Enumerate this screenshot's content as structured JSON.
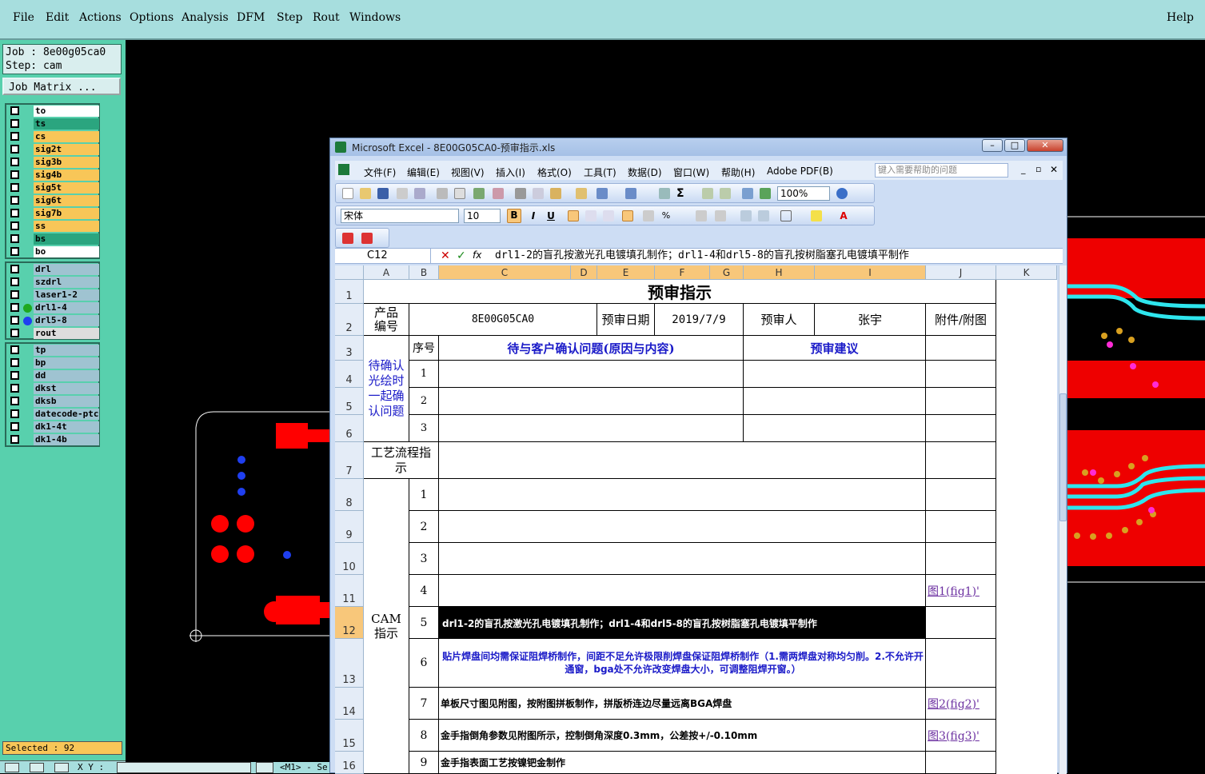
{
  "menubar": {
    "items": [
      "File",
      "Edit",
      "Actions",
      "Options",
      "Analysis",
      "DFM",
      "Step",
      "Rout",
      "Windows"
    ],
    "help": "Help"
  },
  "job": {
    "job_label": "Job : 8e00g05ca0",
    "step_label": "Step: cam",
    "matrix_button": "Job Matrix ..."
  },
  "layers": {
    "group1": [
      {
        "name": "to",
        "color": "#ffffff"
      },
      {
        "name": "ts",
        "color": "#2ba57f"
      },
      {
        "name": "cs",
        "color": "#f8c658"
      },
      {
        "name": "sig2t",
        "color": "#f8c658"
      },
      {
        "name": "sig3b",
        "color": "#f8c658"
      },
      {
        "name": "sig4b",
        "color": "#f8c658"
      },
      {
        "name": "sig5t",
        "color": "#f8c658"
      },
      {
        "name": "sig6t",
        "color": "#f8c658"
      },
      {
        "name": "sig7b",
        "color": "#f8c658"
      },
      {
        "name": "ss",
        "color": "#f8c658"
      },
      {
        "name": "bs",
        "color": "#2ba57f"
      },
      {
        "name": "bo",
        "color": "#ffffff"
      }
    ],
    "group2": [
      {
        "name": "drl",
        "color": "#9fc3d1",
        "mark": ""
      },
      {
        "name": "szdrl",
        "color": "#9fc3d1",
        "mark": ""
      },
      {
        "name": "laser1-2",
        "color": "#9fc3d1",
        "mark": ""
      },
      {
        "name": "drl1-4",
        "color": "#9fc3d1",
        "mark": "#1fa81f"
      },
      {
        "name": "drl5-8",
        "color": "#9fc3d1",
        "mark": "#1f3ff0"
      },
      {
        "name": "rout",
        "color": "#dddddd",
        "mark": ""
      }
    ],
    "group3": [
      {
        "name": "tp",
        "color": "#9fc3d1"
      },
      {
        "name": "bp",
        "color": "#9fc3d1"
      },
      {
        "name": "dd",
        "color": "#9fc3d1"
      },
      {
        "name": "dkst",
        "color": "#9fc3d1"
      },
      {
        "name": "dksb",
        "color": "#9fc3d1"
      },
      {
        "name": "datecode-ptc",
        "color": "#9fc3d1"
      },
      {
        "name": "dk1-4t",
        "color": "#9fc3d1"
      },
      {
        "name": "dk1-4b",
        "color": "#9fc3d1"
      }
    ]
  },
  "status": {
    "selected": "Selected : 92",
    "xy": "X Y :",
    "mode": "<M1> - Se"
  },
  "excel": {
    "title": "Microsoft Excel - 8E00G05CA0-预审指示.xls",
    "menu": [
      "文件(F)",
      "编辑(E)",
      "视图(V)",
      "插入(I)",
      "格式(O)",
      "工具(T)",
      "数据(D)",
      "窗口(W)",
      "帮助(H)",
      "Adobe PDF(B)"
    ],
    "help_placeholder": "键入需要帮助的问题",
    "zoom": "100%",
    "font": "宋体",
    "font_size": "10",
    "name_box": "C12",
    "formula": "drl1-2的盲孔按激光孔电镀填孔制作；drl1-4和drl5-8的盲孔按树脂塞孔电镀填平制作",
    "columns": [
      "A",
      "B",
      "C",
      "D",
      "E",
      "F",
      "G",
      "H",
      "I",
      "J",
      "K"
    ],
    "rows": [
      "1",
      "2",
      "3",
      "4",
      "5",
      "6",
      "7",
      "8",
      "9",
      "10",
      "11",
      "12",
      "13",
      "14",
      "15",
      "16"
    ],
    "sheet": {
      "title": "预审指示",
      "product_no_label": "产品编号",
      "product_no": "8E00G05CA0",
      "review_date_label": "预审日期",
      "review_date": "2019/7/9",
      "reviewer_label": "预审人",
      "reviewer": "张宇",
      "attachment_label": "附件/附图",
      "seq_label": "序号",
      "issue_header": "待与客户确认问题(原因与内容)",
      "suggest_header": "预审建议",
      "pending_label": "待确认光绘时一起确认问题",
      "pending_nums": [
        "1",
        "2",
        "3"
      ],
      "flow_label": "工艺流程指示",
      "cam_label": "CAM指示",
      "cam_nums": [
        "1",
        "2",
        "3",
        "4",
        "5",
        "6",
        "7",
        "8",
        "9"
      ],
      "cam_items": [
        "",
        "",
        "",
        "",
        "drl1-2的盲孔按激光孔电镀填孔制作；drl1-4和drl5-8的盲孔按树脂塞孔电镀填平制作",
        "贴片焊盘间均需保证阻焊桥制作，间距不足允许极限削焊盘保证阻焊桥制作（1.需两焊盘对称均匀削。2.不允许开通窗，bga处不允许改变焊盘大小，可调整阻焊开窗。）",
        "单板尺寸图见附图，按附图拼板制作，拼版桥连边尽量远离BGA焊盘",
        "金手指倒角参数见附图所示，控制倒角深度0.3mm，公差按+/-0.10mm",
        "金手指表面工艺按镍钯金制作"
      ],
      "links": {
        "r11": "图1(fig1)'",
        "r14": "图2(fig2)'",
        "r15": "图3(fig3)'"
      }
    }
  }
}
